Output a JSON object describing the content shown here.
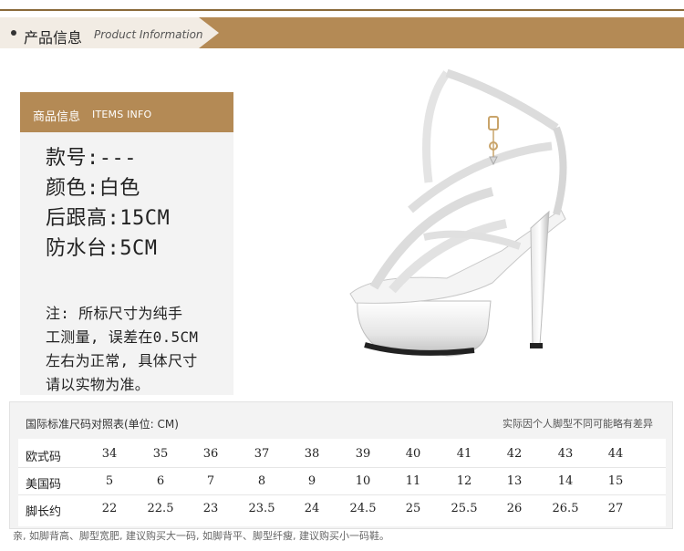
{
  "header": {
    "title_cn": "产品信息",
    "title_en": "Product Information"
  },
  "info": {
    "tab_cn": "商品信息",
    "tab_en": "ITEMS INFO",
    "specs": [
      "款号:---",
      "颜色:白色",
      "后跟高:15CM",
      "防水台:5CM"
    ],
    "note_lines": [
      "注: 所标尺寸为纯手",
      "工测量, 误差在0.5CM",
      "左右为正常, 具体尺寸",
      "请以实物为准。"
    ]
  },
  "size_table": {
    "title": "国际标准尺码对照表(单位: CM)",
    "note": "实际因个人脚型不同可能略有差异",
    "rows": [
      {
        "label": "欧式码",
        "values": [
          "34",
          "35",
          "36",
          "37",
          "38",
          "39",
          "40",
          "41",
          "42",
          "43",
          "44"
        ]
      },
      {
        "label": "美国码",
        "values": [
          "5",
          "6",
          "7",
          "8",
          "9",
          "10",
          "11",
          "12",
          "13",
          "14",
          "15"
        ]
      },
      {
        "label": "脚长约",
        "values": [
          "22",
          "22.5",
          "23",
          "23.5",
          "24",
          "24.5",
          "25",
          "25.5",
          "26",
          "26.5",
          "27"
        ]
      }
    ]
  },
  "footer": {
    "text": "亲, 如脚背高、脚型宽肥, 建议购买大一码, 如脚背平、脚型纤瘦, 建议购买小一码鞋。"
  },
  "colors": {
    "accent": "#b48a55",
    "panel": "#f3f3f3",
    "header_left": "#f2ece4"
  },
  "icons": {
    "product_image": "clear-platform-sandal-image"
  }
}
